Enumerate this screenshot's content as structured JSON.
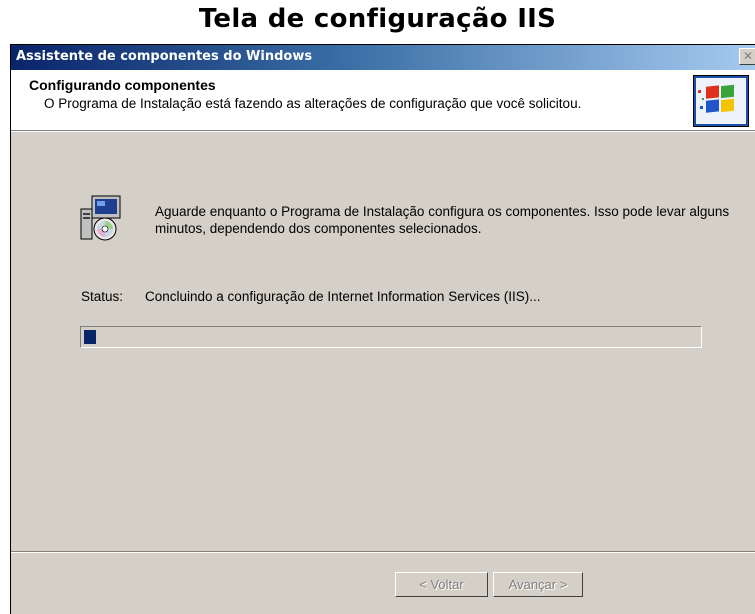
{
  "page_title": "Tela de configuração IIS",
  "window": {
    "title": "Assistente de componentes do Windows",
    "close_glyph": "✕"
  },
  "header": {
    "title": "Configurando componentes",
    "subtitle": "O Programa de Instalação está fazendo as alterações de configuração que você solicitou."
  },
  "body": {
    "message": "Aguarde enquanto o Programa de Instalação configura os componentes. Isso pode levar alguns minutos, dependendo dos componentes selecionados.",
    "status_label": "Status:",
    "status_text": "Concluindo a configuração de Internet Information Services (IIS)...",
    "progress_fraction": 0.02
  },
  "buttons": {
    "back": "< Voltar",
    "next": "Avançar >"
  },
  "icons": {
    "logo": "windows-logo-icon",
    "setup": "computer-setup-cd-icon"
  },
  "colors": {
    "titlebar_start": "#0a246a",
    "titlebar_end": "#a6caf0",
    "dialog_bg": "#d4d0c8",
    "progress": "#0a246a"
  }
}
